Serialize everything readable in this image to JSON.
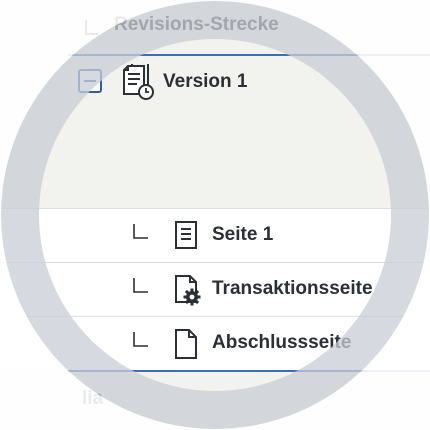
{
  "tree": {
    "parent_label": "Revisions-Strecke",
    "version": {
      "label": "Version 1",
      "toggle_icon": "minus-icon",
      "icon": "document-history-icon"
    },
    "children": [
      {
        "label": "Seite 1",
        "icon": "page-text-icon",
        "branch_icon": "tree-branch-icon"
      },
      {
        "label": "Transaktionsseite",
        "icon": "page-gear-icon",
        "branch_icon": "tree-branch-icon"
      },
      {
        "label": "Abschlussseite",
        "icon": "page-blank-icon",
        "branch_icon": "tree-branch-icon"
      }
    ],
    "next_item_label": "lia"
  },
  "colors": {
    "accent": "#2f5ea8",
    "divider_blue": "#3d6fb6",
    "text": "#2b2f36",
    "ring": "#dfe3e8"
  }
}
